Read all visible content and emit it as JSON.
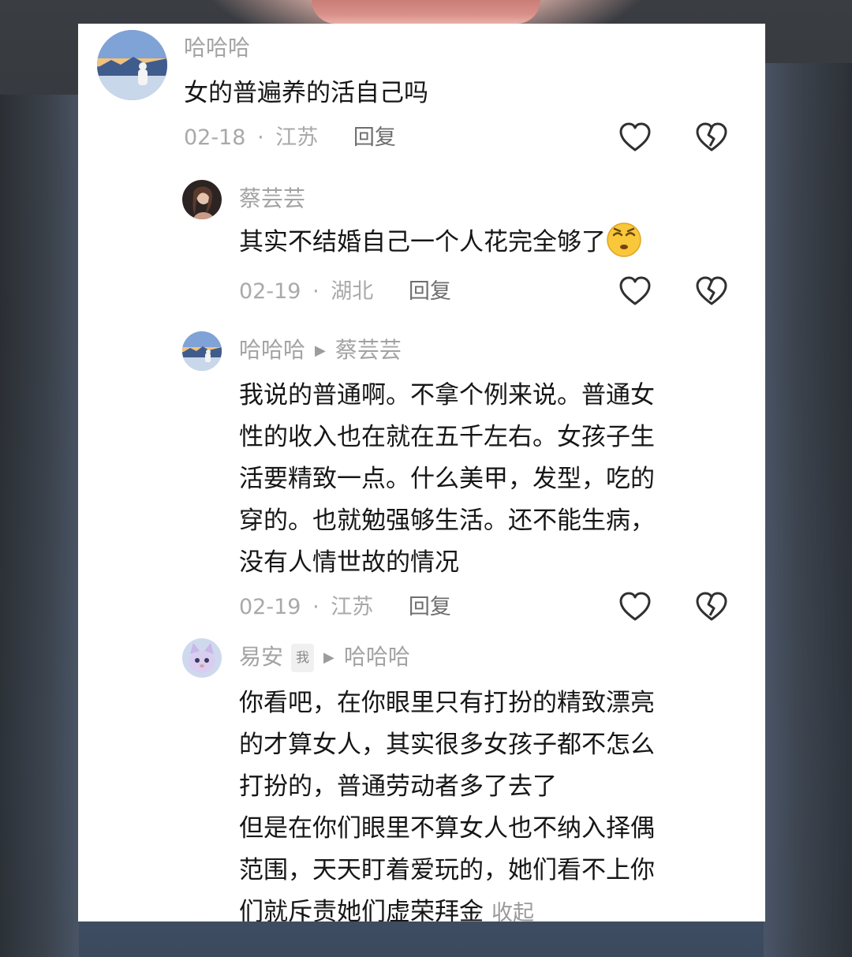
{
  "comments": [
    {
      "name": "哈哈哈",
      "text": "女的普遍养的活自己吗",
      "date": "02-18",
      "location": "江苏",
      "reply": "回复"
    },
    {
      "name": "蔡芸芸",
      "text": "其实不结婚自己一个人花完全够了",
      "date": "02-19",
      "location": "湖北",
      "reply": "回复",
      "emoji": "star-eyes-emoji"
    },
    {
      "name": "哈哈哈",
      "reply_to": "蔡芸芸",
      "lines": [
        "我说的普通啊。不拿个例来说。普通女",
        "性的收入也在就在五千左右。女孩子生",
        "活要精致一点。什么美甲，发型，吃的",
        "穿的。也就勉强够生活。还不能生病，",
        "没有人情世故的情况"
      ],
      "date": "02-19",
      "location": "江苏",
      "reply": "回复"
    },
    {
      "name": "易安",
      "badge": "我",
      "reply_to": "哈哈哈",
      "lines": [
        "你看吧，在你眼里只有打扮的精致漂亮",
        "的才算女人，其实很多女孩子都不怎么",
        "打扮的，普通劳动者多了去了",
        "但是在你们眼里不算女人也不纳入择偶",
        "范围，天天盯着爱玩的，她们看不上你",
        "们就斥责她们虚荣拜金"
      ],
      "collapse": "收起"
    }
  ],
  "separator": "·",
  "icons": {
    "like": "heart-outline-icon",
    "dislike": "broken-heart-icon",
    "reply_arrow": "triangle-right-icon"
  },
  "colors": {
    "name": "#a3a3a3",
    "text": "#161616",
    "meta": "#a9a9a9"
  }
}
